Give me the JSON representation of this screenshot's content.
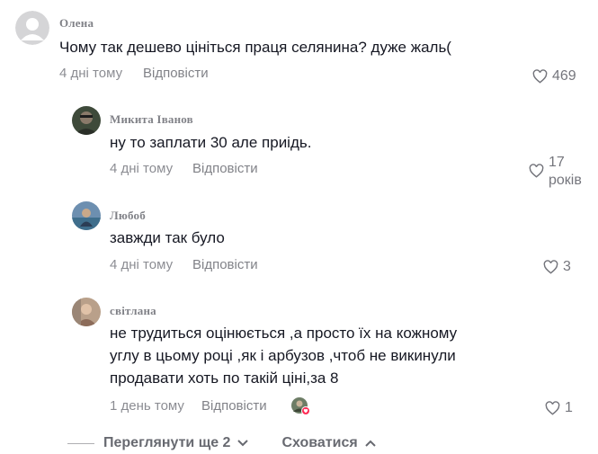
{
  "comments": [
    {
      "username": "Олена",
      "text": "Чому так дешево цініться праця селянина? дуже жаль(",
      "time": "4 дні тому",
      "reply": "Відповісти",
      "likes": "469",
      "avatar_icon": "default-avatar-icon"
    },
    {
      "username": "Микита Іванов",
      "text": "ну то заплати 30 але приідь.",
      "time": "4 дні тому",
      "reply": "Відповісти",
      "likes": "17 років",
      "avatar_icon": "user-photo"
    },
    {
      "username": "Любоб",
      "text": "завжди так було",
      "time": "4 дні тому",
      "reply": "Відповісти",
      "likes": "3",
      "avatar_icon": "user-photo"
    },
    {
      "username": "світлана",
      "text_lines": [
        "не трудиться оцінюється ,а просто їх на кожному",
        "углу в цьому році ,як і арбузов ,чтоб не викинули",
        "продавати хоть по такій ціні,за 8"
      ],
      "time": "1 день тому",
      "reply": "Відповісти",
      "likes": "1",
      "avatar_icon": "user-photo",
      "creator_liked_icon": "creator-liked-badge-icon"
    }
  ],
  "footer": {
    "view_more": "Переглянути ще 2",
    "hide": "Сховатися",
    "view_more_icon": "chevron-down-icon",
    "hide_icon": "chevron-up-icon"
  },
  "colors": {
    "text": "#161823",
    "muted": "rgba(22,24,35,0.5)",
    "creator_badge": "#fe2c55"
  }
}
